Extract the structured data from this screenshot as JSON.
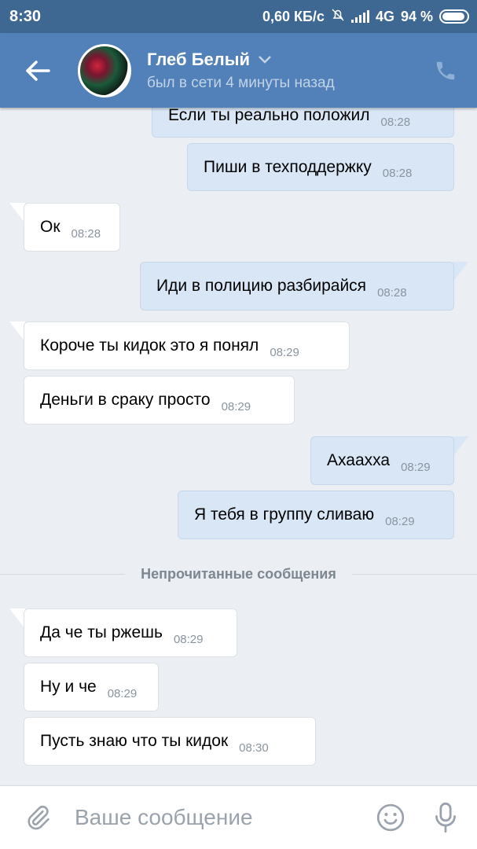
{
  "status": {
    "time": "8:30",
    "speed": "0,60 КБ/с",
    "network": "4G",
    "battery": "94 %",
    "battery_level": 0.94
  },
  "header": {
    "name": "Глеб Белый",
    "status": "был в сети 4 минуты назад"
  },
  "messages": [
    {
      "text": "Если ты реально положил",
      "time": "08:28",
      "dir": "out"
    },
    {
      "text": "Пиши в техподдержку",
      "time": "08:28",
      "dir": "out"
    },
    {
      "text": "Ок",
      "time": "08:28",
      "dir": "in"
    },
    {
      "text": "Иди в полицию разбирайся",
      "time": "08:28",
      "dir": "out"
    },
    {
      "text": "Короче ты кидок это я понял",
      "time": "08:29",
      "dir": "in"
    },
    {
      "text": "Деньги в сраку просто",
      "time": "08:29",
      "dir": "in"
    },
    {
      "text": "Ахаахха",
      "time": "08:29",
      "dir": "out"
    },
    {
      "text": "Я тебя в группу сливаю",
      "time": "08:29",
      "dir": "out"
    },
    {
      "text": "Да че ты ржешь",
      "time": "08:29",
      "dir": "in"
    },
    {
      "text": "Ну и че",
      "time": "08:29",
      "dir": "in"
    },
    {
      "text": "Пусть знаю что ты кидок",
      "time": "08:30",
      "dir": "in"
    }
  ],
  "divider_label": "Непрочитанные сообщения",
  "composer": {
    "placeholder": "Ваше сообщение"
  },
  "colors": {
    "header": "#5181b8",
    "status_bar": "#3e6792",
    "outgoing_bubble": "#d8e6f6",
    "incoming_bubble": "#ffffff",
    "background": "#ebeef2"
  },
  "icons": {
    "back": "arrow-left",
    "dropdown": "chevron-down",
    "call": "phone",
    "attach": "paperclip",
    "emoji": "smiley",
    "voice": "microphone",
    "mute": "bell-off"
  }
}
